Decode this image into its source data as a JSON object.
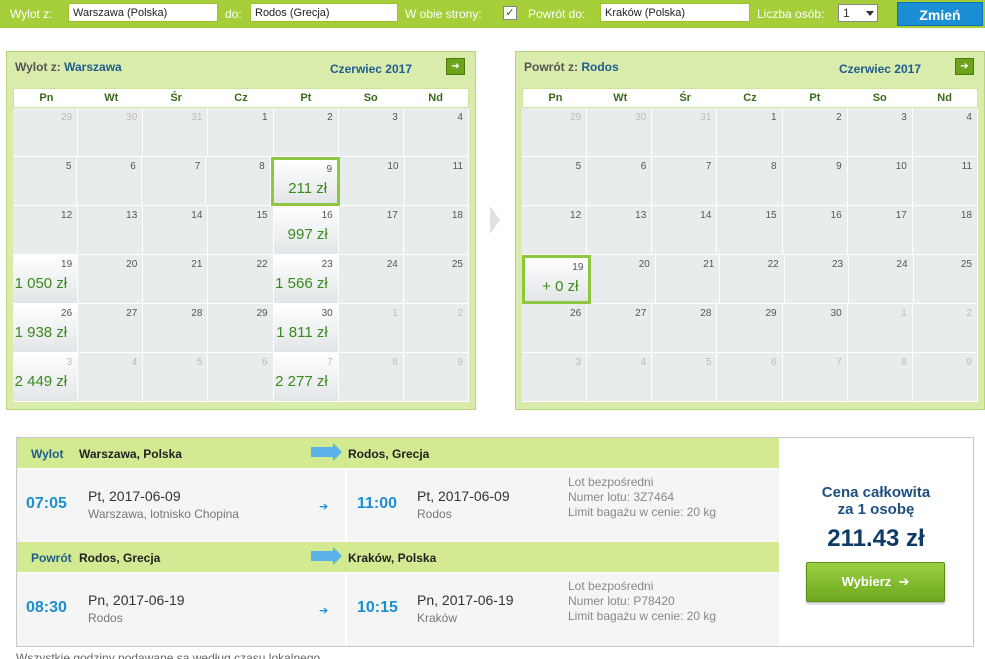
{
  "search": {
    "from_label": "Wylot z:",
    "from_value": "Warszawa (Polska)",
    "to_label": "do:",
    "to_value": "Rodos (Grecja)",
    "roundtrip_label": "W obie strony:",
    "roundtrip_checked": "✓",
    "return_label": "Powrót do:",
    "return_value": "Kraków (Polska)",
    "persons_label": "Liczba osób:",
    "persons_value": "1",
    "change_button": "Zmień"
  },
  "outbound_calendar": {
    "title_prefix": "Wylot z:",
    "title_city": "Warszawa",
    "month": "Czerwiec 2017",
    "weekdays": [
      "Pn",
      "Wt",
      "Śr",
      "Cz",
      "Pt",
      "So",
      "Nd"
    ],
    "weeks": [
      [
        {
          "d": "29",
          "o": true
        },
        {
          "d": "30",
          "o": true
        },
        {
          "d": "31",
          "o": true
        },
        {
          "d": "1"
        },
        {
          "d": "2"
        },
        {
          "d": "3"
        },
        {
          "d": "4"
        }
      ],
      [
        {
          "d": "5"
        },
        {
          "d": "6"
        },
        {
          "d": "7"
        },
        {
          "d": "8"
        },
        {
          "d": "9",
          "p": "211 zł",
          "sel": true
        },
        {
          "d": "10"
        },
        {
          "d": "11"
        }
      ],
      [
        {
          "d": "12"
        },
        {
          "d": "13"
        },
        {
          "d": "14"
        },
        {
          "d": "15"
        },
        {
          "d": "16",
          "p": "997 zł"
        },
        {
          "d": "17"
        },
        {
          "d": "18"
        }
      ],
      [
        {
          "d": "19",
          "p": "1 050 zł"
        },
        {
          "d": "20"
        },
        {
          "d": "21"
        },
        {
          "d": "22"
        },
        {
          "d": "23",
          "p": "1 566 zł"
        },
        {
          "d": "24"
        },
        {
          "d": "25"
        }
      ],
      [
        {
          "d": "26",
          "p": "1 938 zł"
        },
        {
          "d": "27"
        },
        {
          "d": "28"
        },
        {
          "d": "29"
        },
        {
          "d": "30",
          "p": "1 811 zł"
        },
        {
          "d": "1",
          "o": true
        },
        {
          "d": "2",
          "o": true
        }
      ],
      [
        {
          "d": "3",
          "o": true,
          "p": "2 449 zł"
        },
        {
          "d": "4",
          "o": true
        },
        {
          "d": "5",
          "o": true
        },
        {
          "d": "6",
          "o": true
        },
        {
          "d": "7",
          "o": true,
          "p": "2 277 zł"
        },
        {
          "d": "8",
          "o": true
        },
        {
          "d": "9",
          "o": true
        }
      ]
    ]
  },
  "return_calendar": {
    "title_prefix": "Powrót z:",
    "title_city": "Rodos",
    "month": "Czerwiec 2017",
    "weekdays": [
      "Pn",
      "Wt",
      "Śr",
      "Cz",
      "Pt",
      "So",
      "Nd"
    ],
    "weeks": [
      [
        {
          "d": "29",
          "o": true
        },
        {
          "d": "30",
          "o": true
        },
        {
          "d": "31",
          "o": true
        },
        {
          "d": "1"
        },
        {
          "d": "2"
        },
        {
          "d": "3"
        },
        {
          "d": "4"
        }
      ],
      [
        {
          "d": "5"
        },
        {
          "d": "6"
        },
        {
          "d": "7"
        },
        {
          "d": "8"
        },
        {
          "d": "9"
        },
        {
          "d": "10"
        },
        {
          "d": "11"
        }
      ],
      [
        {
          "d": "12"
        },
        {
          "d": "13"
        },
        {
          "d": "14"
        },
        {
          "d": "15"
        },
        {
          "d": "16"
        },
        {
          "d": "17"
        },
        {
          "d": "18"
        }
      ],
      [
        {
          "d": "19",
          "p": "+ 0 zł",
          "sel": true
        },
        {
          "d": "20"
        },
        {
          "d": "21"
        },
        {
          "d": "22"
        },
        {
          "d": "23"
        },
        {
          "d": "24"
        },
        {
          "d": "25"
        }
      ],
      [
        {
          "d": "26"
        },
        {
          "d": "27"
        },
        {
          "d": "28"
        },
        {
          "d": "29"
        },
        {
          "d": "30"
        },
        {
          "d": "1",
          "o": true
        },
        {
          "d": "2",
          "o": true
        }
      ],
      [
        {
          "d": "3",
          "o": true
        },
        {
          "d": "4",
          "o": true
        },
        {
          "d": "5",
          "o": true
        },
        {
          "d": "6",
          "o": true
        },
        {
          "d": "7",
          "o": true
        },
        {
          "d": "8",
          "o": true
        },
        {
          "d": "9",
          "o": true
        }
      ]
    ]
  },
  "outbound": {
    "label": "Wylot",
    "from": "Warszawa, Polska",
    "to": "Rodos, Grecja",
    "dep_time": "07:05",
    "dep_day": "Pt,",
    "dep_date": "2017-06-09",
    "dep_place": "Warszawa, lotnisko Chopina",
    "arr_time": "11:00",
    "arr_day": "Pt,",
    "arr_date": "2017-06-09",
    "arr_place": "Rodos",
    "info1": "Lot bezpośredni",
    "info2": "Numer lotu: 3Z7464",
    "info3": "Limit bagażu w cenie: 20 kg"
  },
  "inbound": {
    "label": "Powrót",
    "from": "Rodos, Grecja",
    "to": "Kraków, Polska",
    "dep_time": "08:30",
    "dep_day": "Pn,",
    "dep_date": "2017-06-19",
    "dep_place": "Rodos",
    "arr_time": "10:15",
    "arr_day": "Pn,",
    "arr_date": "2017-06-19",
    "arr_place": "Kraków",
    "info1": "Lot bezpośredni",
    "info2": "Numer lotu: P78420",
    "info3": "Limit bagażu w cenie: 20 kg"
  },
  "total": {
    "label_line1": "Cena całkowita",
    "label_line2": "za 1 osobę",
    "value": "211.43 zł",
    "button": "Wybierz"
  },
  "footnote": "Wszystkie godziny podawane są według czasu lokalnego."
}
